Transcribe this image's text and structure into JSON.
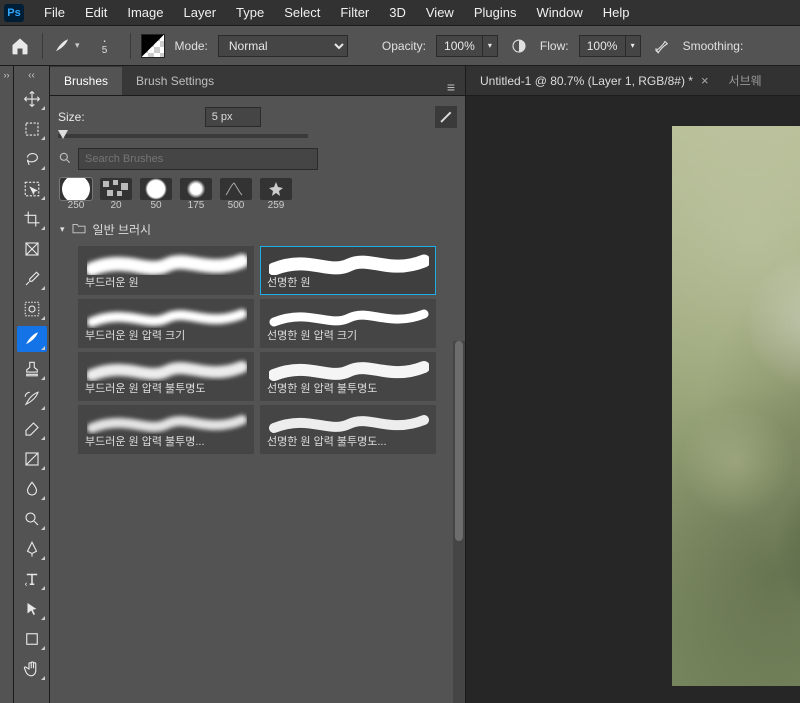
{
  "menu": [
    "File",
    "Edit",
    "Image",
    "Layer",
    "Type",
    "Select",
    "Filter",
    "3D",
    "View",
    "Plugins",
    "Window",
    "Help"
  ],
  "options": {
    "size_dot_value": "5",
    "mode_label": "Mode:",
    "mode_value": "Normal",
    "opacity_label": "Opacity:",
    "opacity_value": "100%",
    "flow_label": "Flow:",
    "flow_value": "100%",
    "smoothing_label": "Smoothing:"
  },
  "panel": {
    "tabs": {
      "brushes": "Brushes",
      "settings": "Brush Settings"
    },
    "size_label": "Size:",
    "size_value": "5 px",
    "search_placeholder": "Search Brushes",
    "recent": [
      {
        "label": "250"
      },
      {
        "label": "20"
      },
      {
        "label": "50"
      },
      {
        "label": "175"
      },
      {
        "label": "500"
      },
      {
        "label": "259"
      }
    ],
    "folder_name": "일반 브러시",
    "brushes_left": [
      "부드러운 원",
      "부드러운 원 압력 크기",
      "부드러운 원 압력 불투명도",
      "부드러운 원 압력 불투명..."
    ],
    "brushes_right": [
      "선명한 원",
      "선명한 원 압력 크기",
      "선명한 원 압력 불투명도",
      "선명한 원 압력 불투명도..."
    ]
  },
  "document": {
    "tab_title": "Untitled-1 @ 80.7% (Layer 1, RGB/8#) *",
    "other_tab": "서브웨"
  }
}
